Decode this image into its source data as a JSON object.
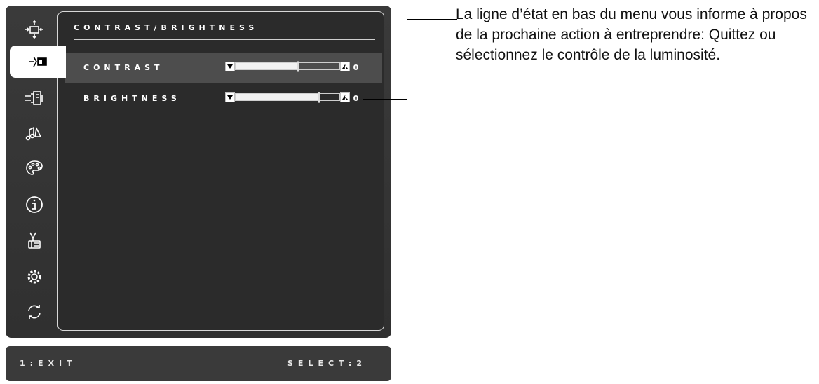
{
  "menu": {
    "title": "CONTRAST/BRIGHTNESS",
    "rows": [
      {
        "label": "CONTRAST",
        "value": "60",
        "level": 60
      },
      {
        "label": "BRIGHTNESS",
        "value": "80",
        "level": 80
      }
    ]
  },
  "sidebar_icons": [
    "auto-adjust-icon",
    "contrast-brightness-icon",
    "input-select-icon",
    "audio-adjust-icon",
    "color-adjust-icon",
    "information-icon",
    "manual-image-adjust-icon",
    "setup-menu-icon",
    "memory-recall-icon"
  ],
  "status_bar": {
    "left": "1:EXIT",
    "right": "SELECT:2"
  },
  "callout": {
    "text": "La ligne d’état en bas du menu vous informe à propos de la prochaine action à entreprendre: Quittez ou sélectionnez le contrôle de la luminosité."
  }
}
